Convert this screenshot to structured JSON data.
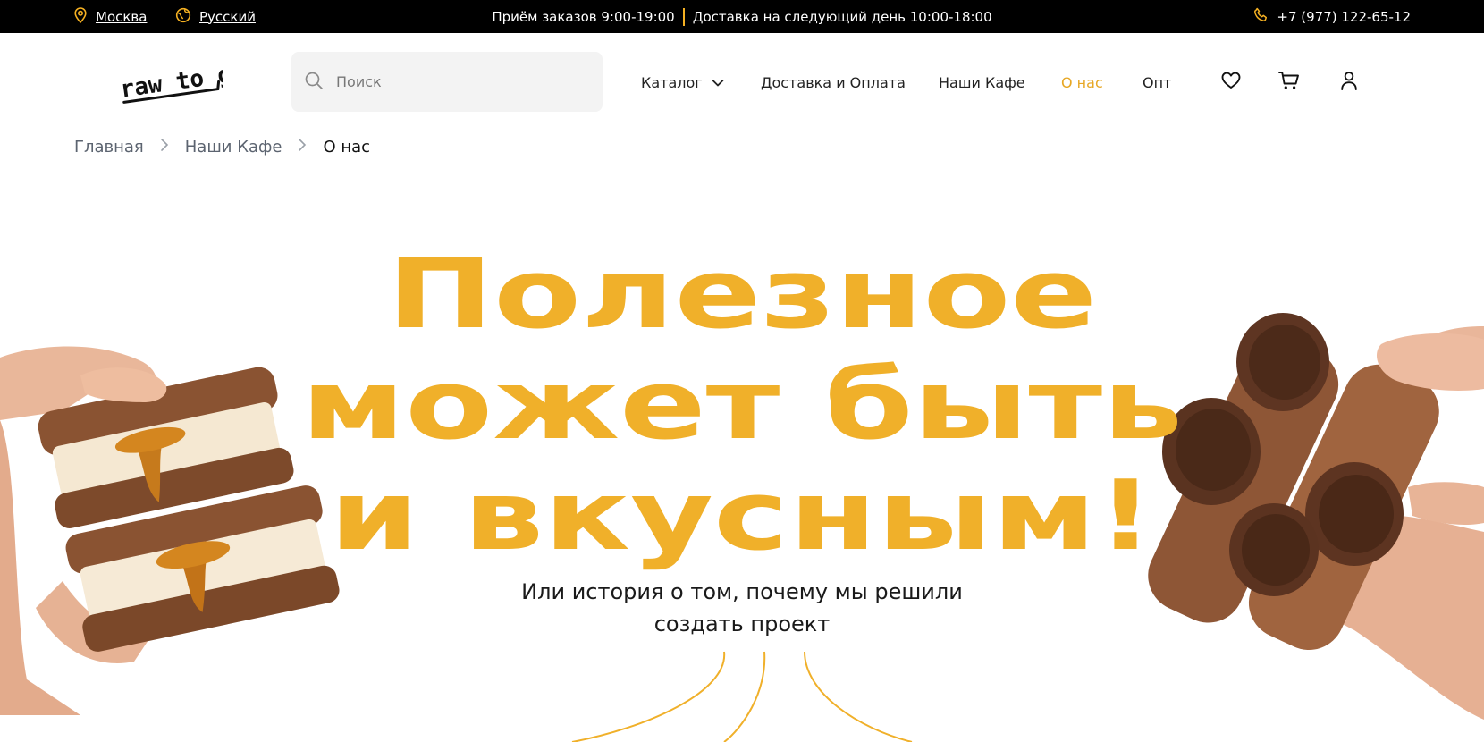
{
  "topbar": {
    "city": "Москва",
    "language": "Русский",
    "hours": "Приём заказов 9:00-19:00",
    "delivery": "Доставка на следующий день 10:00-18:00",
    "phone": "+7 (977) 122-65-12"
  },
  "header": {
    "logo_text": "raw to go",
    "search_placeholder": "Поиск",
    "nav": {
      "catalog": "Каталог",
      "delivery": "Доставка и Оплата",
      "cafes": "Наши Кафе",
      "about": "О нас",
      "wholesale": "Опт"
    }
  },
  "breadcrumb": {
    "home": "Главная",
    "cafes": "Наши Кафе",
    "current": "О нас"
  },
  "hero": {
    "title_line1": "Полезное",
    "title_line2": "может быть",
    "title_line3": "и вкусным!",
    "subtitle_line1": "Или история о том, почему мы решили",
    "subtitle_line2": "создать проект"
  },
  "icons": {
    "location": "location-pin-icon",
    "globe": "globe-icon",
    "phone": "phone-icon",
    "search": "search-icon",
    "chevron": "chevron-down-icon",
    "favorite": "heart-icon",
    "cart": "cart-icon",
    "user": "user-icon"
  },
  "colors": {
    "accent": "#f0b02a",
    "topbar_bg": "#000000",
    "active_nav": "#e7a724"
  }
}
